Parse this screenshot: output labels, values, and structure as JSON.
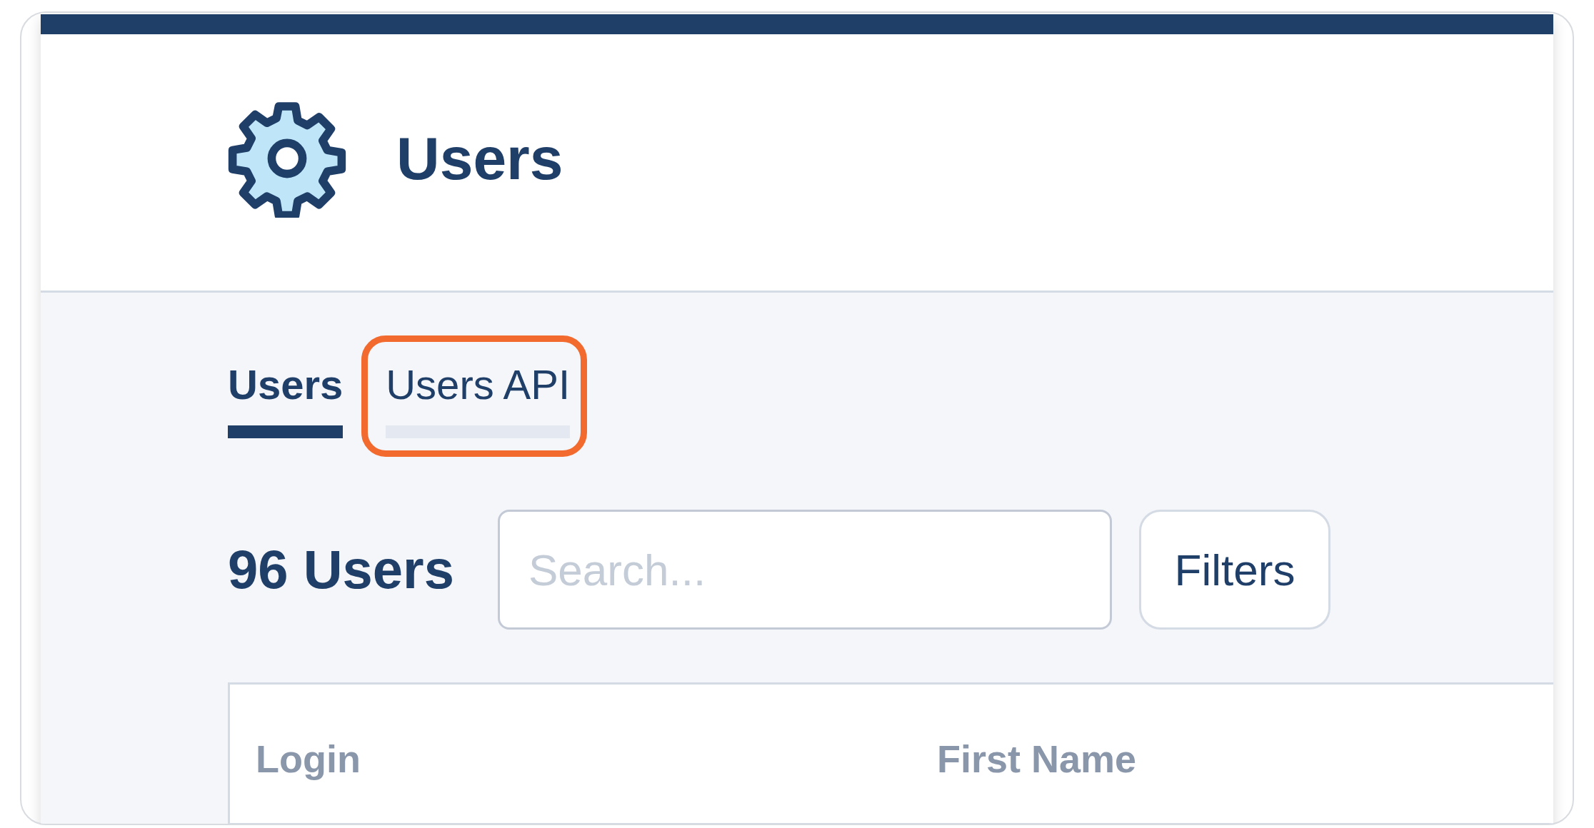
{
  "page_title": "Users",
  "tabs": [
    {
      "label": "Users",
      "selected": true,
      "highlighted": false
    },
    {
      "label": "Users API",
      "selected": false,
      "highlighted": true
    }
  ],
  "count": "96 Users",
  "search": {
    "placeholder": "Search..."
  },
  "filters_button": "Filters",
  "table": {
    "columns": [
      "Login",
      "First Name"
    ]
  }
}
